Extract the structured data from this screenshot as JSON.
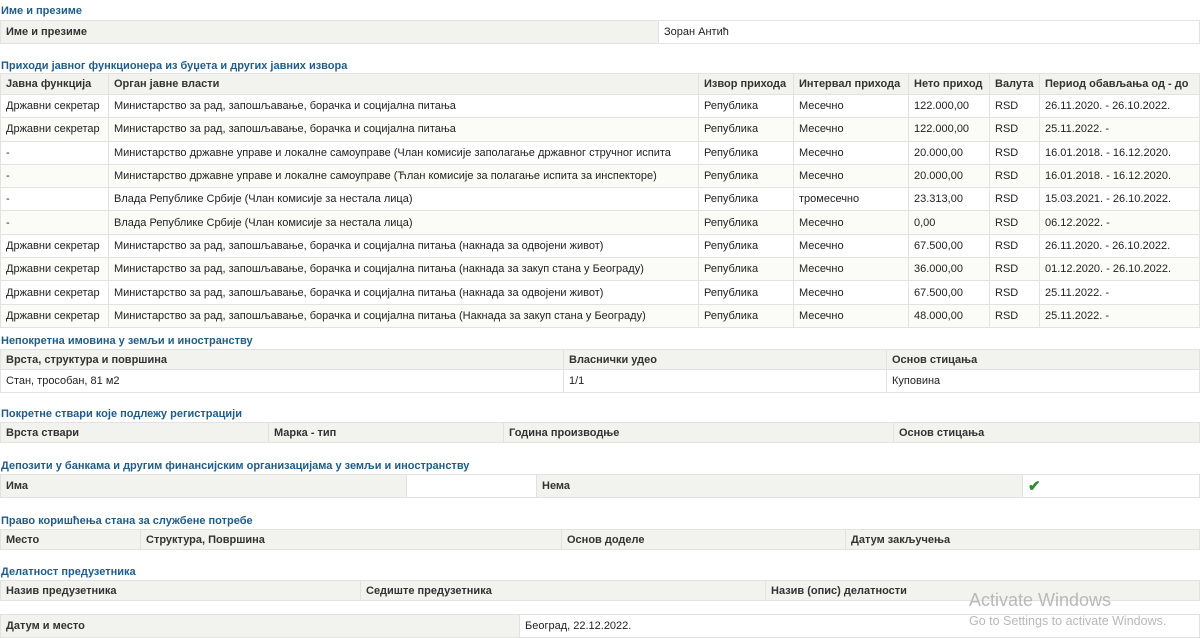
{
  "name_section": {
    "title": "Име и презиме",
    "label": "Име и презиме",
    "value": "Зоран Антић"
  },
  "income_section": {
    "title": "Приходи јавног функционера из буџета и других јавних извора",
    "headers": [
      "Јавна функција",
      "Орган јавне власти",
      "Извор прихода",
      "Интервал прихода",
      "Нето приход",
      "Валута",
      "Период обављања од - до"
    ],
    "rows": [
      [
        "Државни секретар",
        "Министарство за рад, запошљавање, борачка и социјална питања",
        "Република",
        "Месечно",
        "122.000,00",
        "RSD",
        "26.11.2020. - 26.10.2022."
      ],
      [
        "Државни секретар",
        "Министарство за рад, запошљавање, борачка и социјална питања",
        "Република",
        "Месечно",
        "122.000,00",
        "RSD",
        "25.11.2022. -"
      ],
      [
        "-",
        "Министарство државне управе и локалне самоуправе (Члан комисије заполагање државног стручног испита",
        "Република",
        "Месечно",
        "20.000,00",
        "RSD",
        "16.01.2018. - 16.12.2020."
      ],
      [
        "-",
        "Министарство државне управе и локалне самоуправе (Ћлан комисије за полагање испита за инспекторе)",
        "Република",
        "Месечно",
        "20.000,00",
        "RSD",
        "16.01.2018. - 16.12.2020."
      ],
      [
        "-",
        "Влада Републике Србије (Члан комисије за нестала лица)",
        "Република",
        "тромесечно",
        "23.313,00",
        "RSD",
        "15.03.2021. - 26.10.2022."
      ],
      [
        "-",
        "Влада Републике Србије (Члан комисије за нестала лица)",
        "Република",
        "Месечно",
        "0,00",
        "RSD",
        "06.12.2022. -"
      ],
      [
        "Државни секретар",
        "Министарство за рад, запошљавање, борачка и социјална питања (накнада за одвојени живот)",
        "Република",
        "Месечно",
        "67.500,00",
        "RSD",
        "26.11.2020. - 26.10.2022."
      ],
      [
        "Државни секретар",
        "Министарство за рад, запошљавање, борачка и социјална питања (накнада за закуп стана у Београду)",
        "Република",
        "Месечно",
        "36.000,00",
        "RSD",
        "01.12.2020. - 26.10.2022."
      ],
      [
        "Државни секретар",
        "Министарство за рад, запошљавање, борачка и социјална питања (накнада за одвојени живот)",
        "Република",
        "Месечно",
        "67.500,00",
        "RSD",
        "25.11.2022. -"
      ],
      [
        "Државни секретар",
        "Министарство за рад, запошљавање, борачка и социјална питања (Накнада за закуп стана у Београду)",
        "Република",
        "Месечно",
        "48.000,00",
        "RSD",
        "25.11.2022. -"
      ]
    ]
  },
  "real_estate": {
    "title": "Непокретна имовина у земљи и иностранству",
    "headers": [
      "Врста, структура и површина",
      "Власнички удео",
      "Основ стицања"
    ],
    "row": [
      "Стан, трособан, 81 м2",
      "1/1",
      "Куповина"
    ]
  },
  "movables": {
    "title": "Покретне ствари које подлежу регистрацији",
    "headers": [
      "Врста ствари",
      "Марка - тип",
      "Година производње",
      "Основ стицања"
    ]
  },
  "deposits": {
    "title": "Депозити у банкама и другим финансијским организацијама у земљи и иностранству",
    "has_label": "Има",
    "none_label": "Нема",
    "selected": "Нема",
    "check_icon": "checkmark-icon",
    "check_color": "#2e8b2e"
  },
  "housing": {
    "title": "Право коришћења стана за службене потребе",
    "headers": [
      "Место",
      "Структура, Површина",
      "Основ доделе",
      "Датум закључења"
    ]
  },
  "entrepreneur": {
    "title": "Делатност предузетника",
    "headers": [
      "Назив предузетника",
      "Седиште предузетника",
      "Назив (опис) делатности"
    ]
  },
  "footer": {
    "label": "Датум и место",
    "value": "Београд, 22.12.2022."
  },
  "watermark": {
    "line1": "Activate Windows",
    "line2": "Go to Settings to activate Windows."
  }
}
